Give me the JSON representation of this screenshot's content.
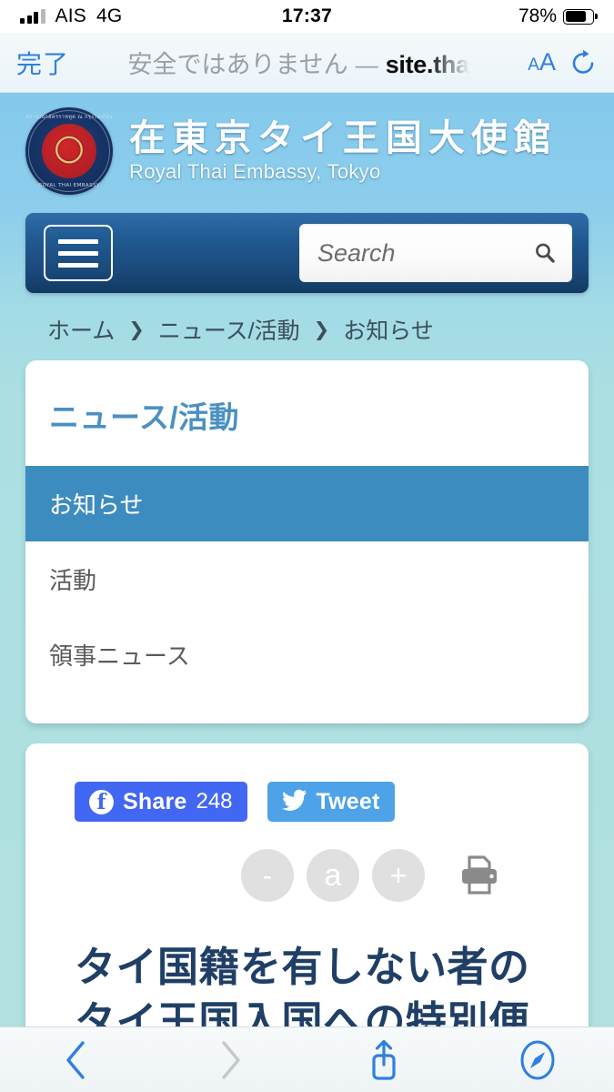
{
  "status_bar": {
    "carrier": "AIS",
    "network": "4G",
    "time": "17:37",
    "battery_percent": "78%",
    "battery_level": 78,
    "signal_bars_filled": 3,
    "signal_bars_total": 4
  },
  "browser": {
    "done_label": "完了",
    "security_warning": "安全ではありません",
    "separator": "—",
    "url_host": "site.tha",
    "text_size_small": "A",
    "text_size_large": "A",
    "reload_icon": "reload-icon",
    "toolbar": {
      "back_icon": "chevron-left-icon",
      "forward_icon": "chevron-right-icon",
      "share_icon": "share-icon",
      "tabs_icon": "safari-compass-icon",
      "back_enabled": true,
      "forward_enabled": false
    }
  },
  "site_header": {
    "emblem_alt": "royal-thai-embassy-seal",
    "emblem_text_top": "สถานเอกอัครราชทูต ณ กรุงโตเกียว",
    "emblem_text_bottom": "ROYAL THAI EMBASSY",
    "title_jp": "在東京タイ王国大使館",
    "title_en": "Royal Thai Embassy, Tokyo"
  },
  "nav": {
    "menu_icon": "hamburger-menu-icon",
    "search_placeholder": "Search",
    "search_value": "",
    "search_icon": "magnifier-icon"
  },
  "breadcrumb": {
    "items": [
      "ホーム",
      "ニュース/活動",
      "お知らせ"
    ],
    "separator": "❯"
  },
  "news_card": {
    "title": "ニュース/活動",
    "menu": [
      {
        "label": "お知らせ",
        "active": true
      },
      {
        "label": "活動",
        "active": false
      },
      {
        "label": "領事ニュース",
        "active": false
      }
    ]
  },
  "article": {
    "facebook": {
      "icon": "facebook-icon",
      "label": "Share",
      "count": "248"
    },
    "twitter": {
      "icon": "twitter-bird-icon",
      "label": "Tweet"
    },
    "font_controls": [
      {
        "name": "font-decrease",
        "glyph": "-"
      },
      {
        "name": "font-default",
        "glyph": "a"
      },
      {
        "name": "font-increase",
        "glyph": "+"
      }
    ],
    "print_icon": "printer-icon",
    "headline": "タイ国籍を有しない者のタイ王国入国への特別便"
  },
  "colors": {
    "page_top": "#84c9ec",
    "page_bottom": "#b0e0e0",
    "nav_gradient_top": "#2f6da8",
    "nav_gradient_bottom": "#123a63",
    "accent_blue": "#4a90c4",
    "active_item": "#3d8cbf",
    "headline_navy": "#1f3f66",
    "facebook_blue": "#4267f2",
    "twitter_blue": "#4da2e8",
    "ios_blue": "#2f7fe0"
  }
}
